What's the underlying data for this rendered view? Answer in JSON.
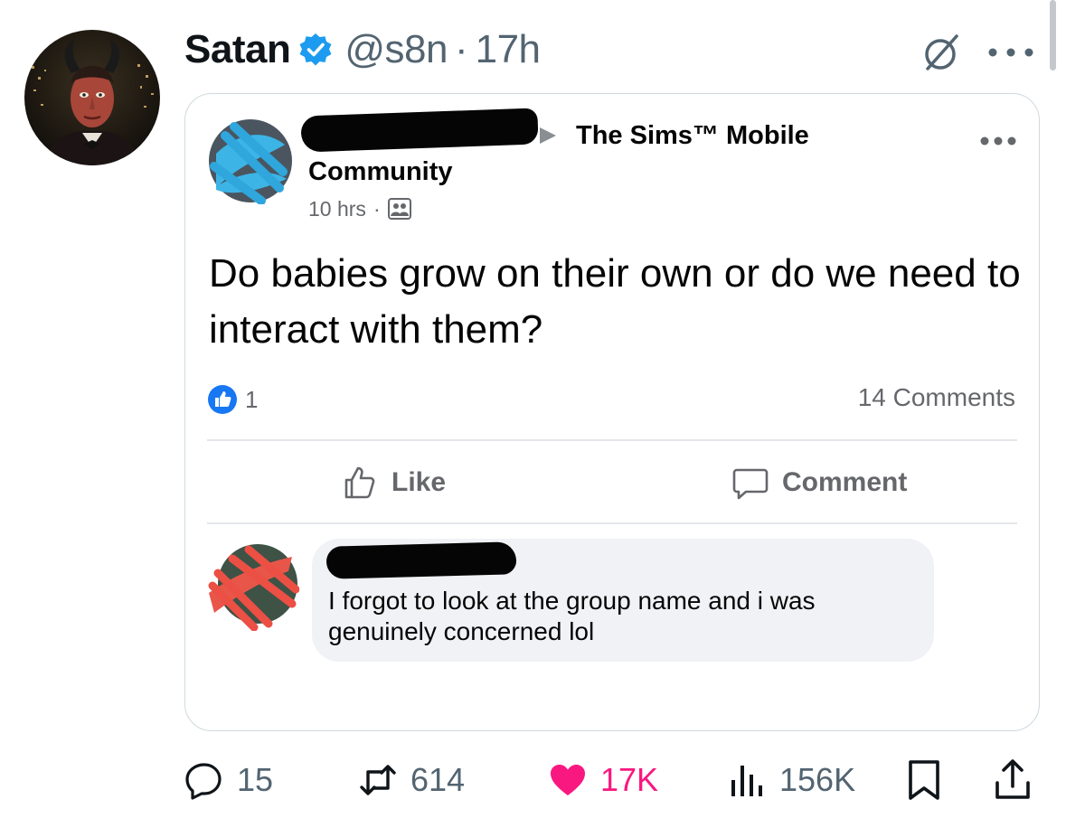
{
  "tweet": {
    "author_name": "Satan",
    "handle": "@s8n",
    "separator": "·",
    "time": "17h",
    "verified": true
  },
  "embedded_post": {
    "group": "The Sims™ Mobile",
    "group_suffix": "Community",
    "time": "10 hrs",
    "meta_separator": "·",
    "text": "Do babies grow on their own or do we need to interact with them?",
    "like_count": "1",
    "comments_count": "14 Comments",
    "like_label": "Like",
    "comment_label": "Comment",
    "comment": {
      "text": "I forgot to look at the group name and i was genuinely concerned lol"
    }
  },
  "stats": {
    "replies": "15",
    "retweets": "614",
    "likes": "17K",
    "views": "156K"
  },
  "colors": {
    "verified_blue": "#1d9bf0",
    "like_pink": "#f91880",
    "secondary_text": "#536471",
    "fb_like_blue": "#1877f2"
  }
}
